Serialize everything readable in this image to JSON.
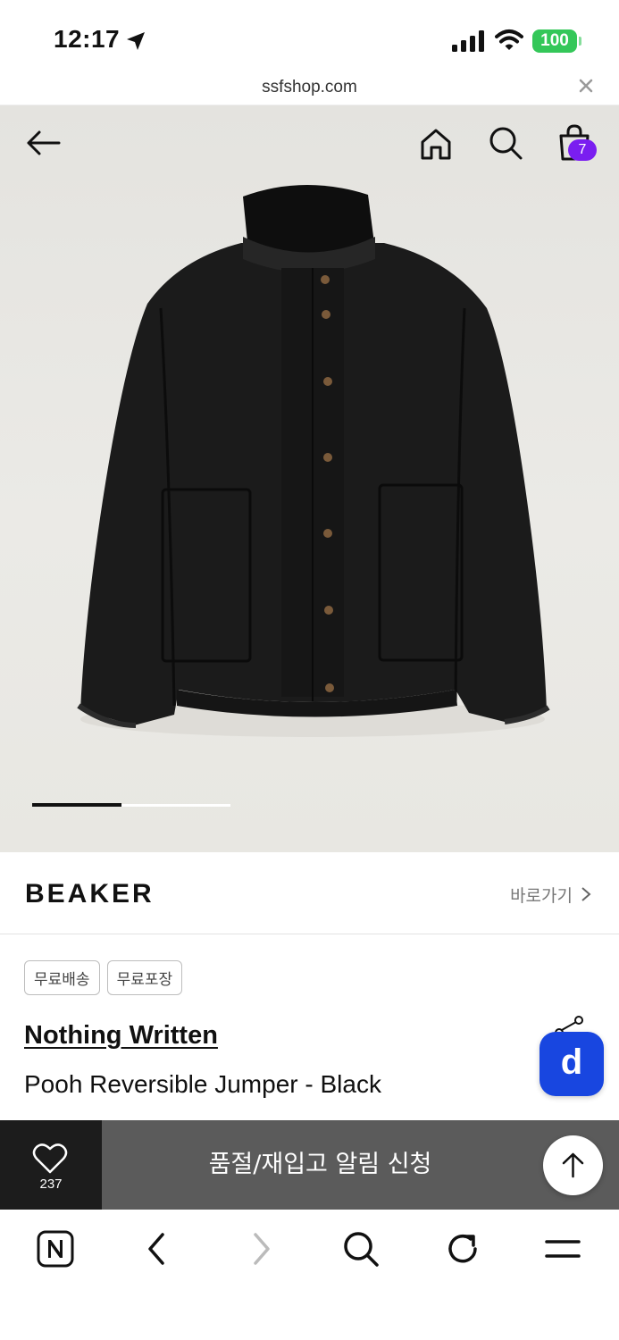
{
  "status_bar": {
    "time": "12:17",
    "battery": "100"
  },
  "url_bar": {
    "domain": "ssfshop.com"
  },
  "header": {
    "cart_count": "7"
  },
  "brand": {
    "name": "BEAKER",
    "link_label": "바로가기"
  },
  "tags": [
    "무료배송",
    "무료포장"
  ],
  "product": {
    "brand": "Nothing Written",
    "name": "Pooh Reversible Jumper - Black"
  },
  "app_badge": {
    "letter": "d"
  },
  "action_bar": {
    "like_count": "237",
    "restock_label": "품절/재입고 알림 신청"
  },
  "colors": {
    "cart_badge": "#7a1ef0",
    "app_badge": "#1846e0",
    "battery": "#34c759",
    "action_button": "#5b5b5b",
    "like_box": "#1c1c1c"
  },
  "icons": [
    "location-arrow-icon",
    "cellular-signal-icon",
    "wifi-icon",
    "close-icon",
    "back-arrow-icon",
    "home-icon",
    "search-icon",
    "shopping-bag-icon",
    "chevron-right-icon",
    "share-icon",
    "heart-icon",
    "arrow-up-icon",
    "naver-icon",
    "chevron-left-icon",
    "refresh-icon",
    "menu-icon"
  ]
}
